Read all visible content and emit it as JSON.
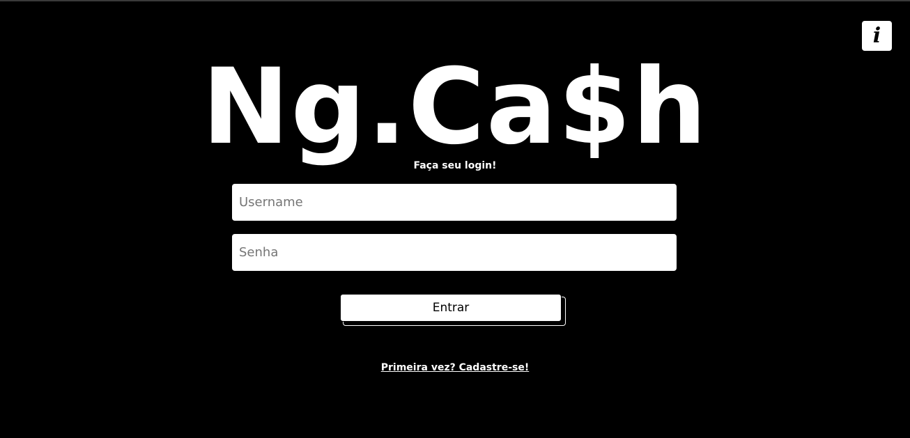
{
  "header": {
    "info_icon_glyph": "i"
  },
  "logo": {
    "text": "Ng.Ca$h"
  },
  "login": {
    "subtitle": "Faça seu login!",
    "username_placeholder": "Username",
    "username_value": "",
    "password_placeholder": "Senha",
    "password_value": "",
    "submit_label": "Entrar",
    "signup_link": "Primeira vez? Cadastre-se!"
  },
  "colors": {
    "background": "#000000",
    "foreground": "#ffffff"
  }
}
